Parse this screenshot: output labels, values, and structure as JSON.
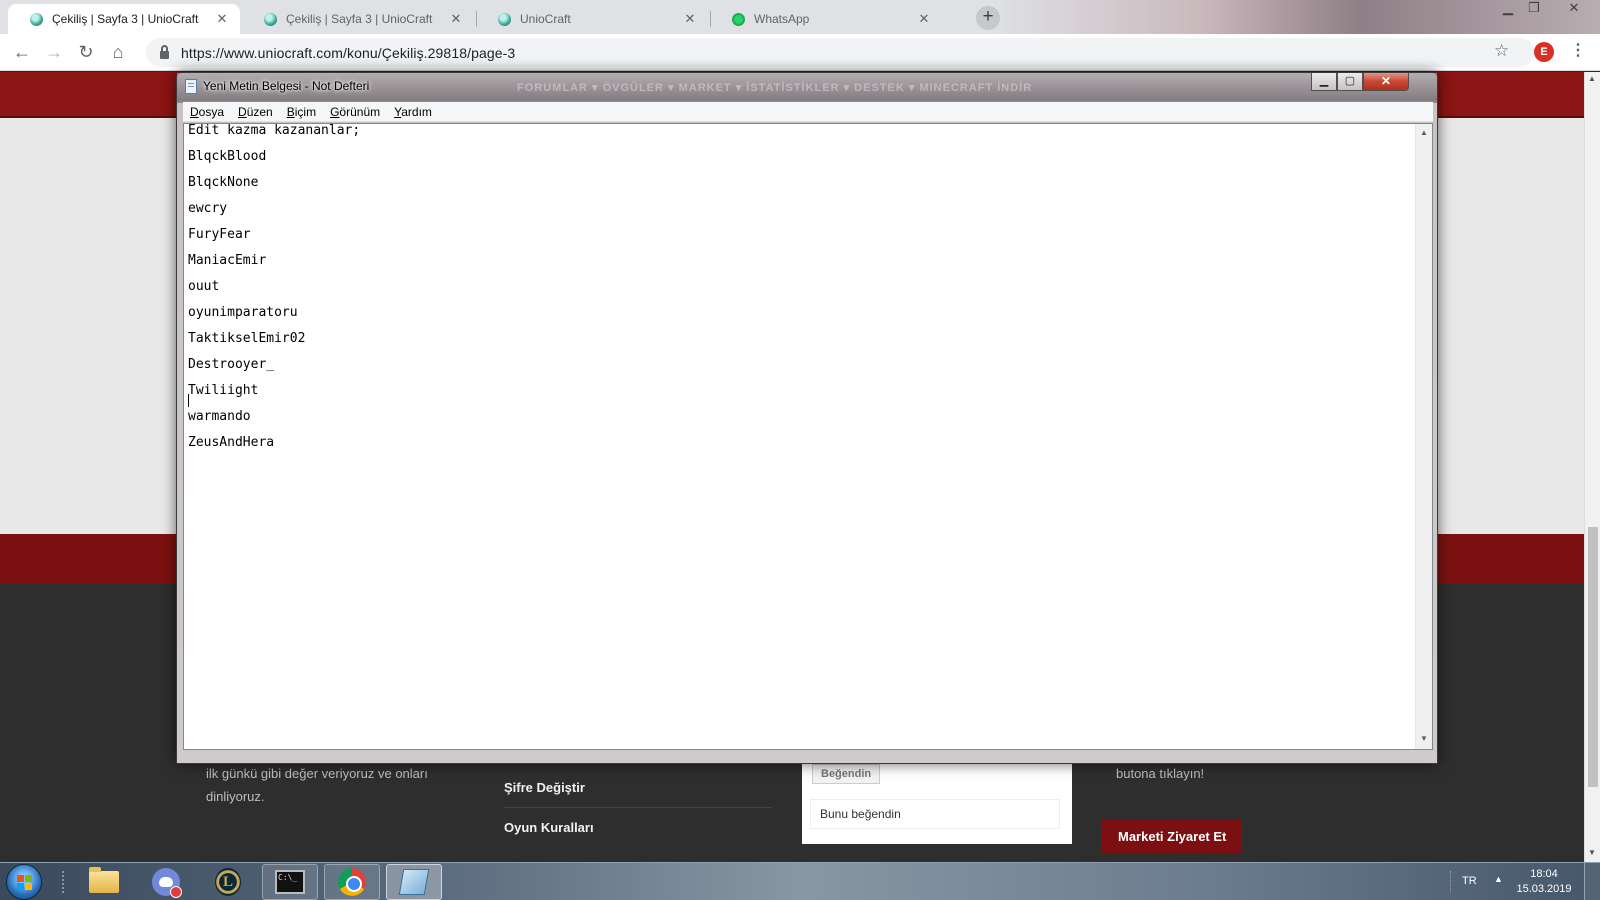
{
  "browser": {
    "tabs": [
      {
        "title": "Çekiliş | Sayfa 3 | UnioCraft",
        "active": true
      },
      {
        "title": "Çekiliş | Sayfa 3 | UnioCraft",
        "active": false
      },
      {
        "title": "UnioCraft",
        "active": false
      },
      {
        "title": "WhatsApp",
        "active": false
      }
    ],
    "url": "https://www.uniocraft.com/konu/Çekiliş.29818/page-3",
    "profile_initial": "E"
  },
  "website": {
    "nav_ghost": "FORUMLAR ▾   ÖVGÜLER ▾   MARKET ▾   İSTATİSTİKLER ▾   DESTEK ▾   MINECRAFT İNDİR",
    "footer_text_line1": "ilk günkü gibi değer veriyoruz ve onları",
    "footer_text_line2": "dinliyoruz.",
    "footer_links": [
      "Şifre Değiştir",
      "Oyun Kuralları"
    ],
    "like_button": "Beğendin",
    "like_text": "Bunu beğendin",
    "market_text": "butona tıklayın!",
    "market_button": "Marketi Ziyaret Et"
  },
  "notepad": {
    "title": "Yeni Metin Belgesi - Not Defteri",
    "menu": [
      {
        "key": "D",
        "rest": "osya"
      },
      {
        "key": "D",
        "rest": "üzen"
      },
      {
        "key": "B",
        "rest": "içim"
      },
      {
        "key": "G",
        "rest": "örünüm"
      },
      {
        "key": "Y",
        "rest": "ardım"
      }
    ],
    "lines": [
      "Edit kazma kazananlar;",
      "BlqckBlood",
      "BlqckNone",
      "ewcry",
      "FuryFear",
      "ManiacEmir",
      "ouut",
      "oyunimparatoru",
      "TaktikselEmir02",
      "Destrooyer_",
      "Twiliight",
      "warmando",
      "ZeusAndHera"
    ]
  },
  "taskbar": {
    "language": "TR",
    "time": "18:04",
    "date": "15.03.2019",
    "apps": [
      "folder-icon",
      "discord-icon",
      "league-of-legends-icon",
      "cmd-icon",
      "chrome-icon",
      "notepad-icon"
    ]
  },
  "colors": {
    "site_red": "#8b1414",
    "footer_bg": "#2e2e2e",
    "market_button": "#7b0f12"
  }
}
